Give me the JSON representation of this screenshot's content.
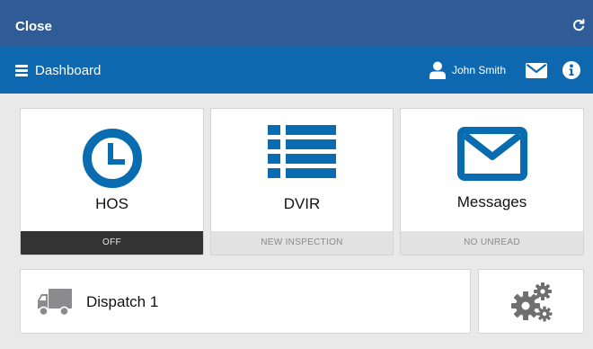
{
  "topbar": {
    "close_label": "Close"
  },
  "navbar": {
    "title": "Dashboard",
    "user_name": "John Smith"
  },
  "tiles": {
    "hos": {
      "label": "HOS",
      "status": "OFF"
    },
    "dvir": {
      "label": "DVIR",
      "status": "NEW INSPECTION"
    },
    "messages": {
      "label": "Messages",
      "status": "NO UNREAD"
    },
    "dispatch": {
      "label": "Dispatch 1"
    }
  },
  "colors": {
    "topbar": "#2f5b96",
    "navbar": "#0d68b0",
    "accent_icon": "#0a6cb0",
    "status_dark": "#333333",
    "status_light": "#e2e2e3",
    "gear_icon": "#6f6f70",
    "truck_icon": "#8b8b8d"
  },
  "icons": {
    "refresh": "refresh-icon",
    "menu": "hamburger-icon",
    "user": "user-icon",
    "mail": "envelope-icon",
    "info": "info-icon",
    "hos": "clock-icon",
    "dvir": "list-icon",
    "messages": "envelope-icon",
    "dispatch": "truck-icon",
    "settings": "gears-icon"
  }
}
